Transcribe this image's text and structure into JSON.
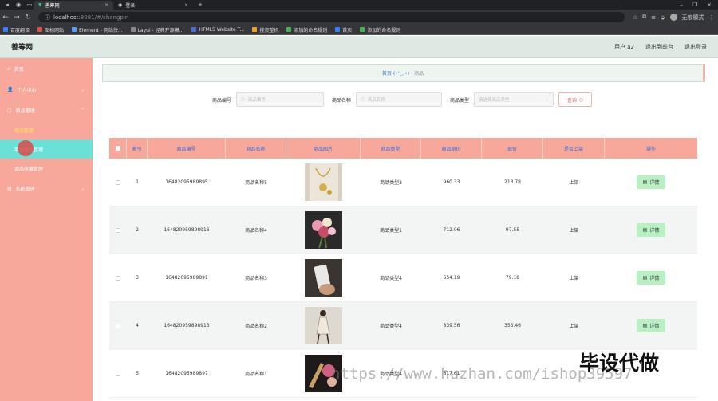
{
  "browser": {
    "tabs": [
      {
        "label": "善筹网"
      },
      {
        "label": "登录"
      }
    ],
    "url_host": "localhost",
    "url_path": ":8081/#/shangpin",
    "profile_label": "无痕模式",
    "bookmarks": [
      {
        "label": "百度翻译",
        "color": "#3b7cff"
      },
      {
        "label": "图标网站",
        "color": "#e0504a"
      },
      {
        "label": "Element - 网站快...",
        "color": "#4fa0ff"
      },
      {
        "label": "Layui - 经典开源模...",
        "color": "#888888"
      },
      {
        "label": "HTML5 Website T...",
        "color": "#4f6bd8"
      },
      {
        "label": "搜资整机",
        "color": "#f0a030"
      },
      {
        "label": "添加的命名规则",
        "color": "#4caf50"
      },
      {
        "label": "首页",
        "color": "#3b7cff"
      },
      {
        "label": "添加的命名规则",
        "color": "#4caf50"
      }
    ]
  },
  "header": {
    "logo": "善筹网",
    "user": "用户 a2",
    "back": "退出到前台",
    "logout": "退出登录"
  },
  "sidebar": {
    "home": "首页",
    "personal": "个人中心",
    "goods_mgmt": "商品管理",
    "sub_yellow": "商品管理",
    "sub_active": "商品类型管理",
    "sub_3": "商品收藏管理",
    "system": "系统管理"
  },
  "breadcrumb": {
    "home": "首页",
    "face": "(•'◡'•)",
    "current": "商品"
  },
  "filters": {
    "code_label": "商品编号",
    "code_placeholder": "商品编号",
    "name_label": "商品名称",
    "name_placeholder": "商品名称",
    "type_label": "商品类型",
    "type_placeholder": "请选择商品类型",
    "query": "查询"
  },
  "table": {
    "headers": [
      "索引",
      "商品编号",
      "商品名称",
      "商品图片",
      "商品类型",
      "商品原价",
      "现价",
      "是否上架",
      "操作"
    ],
    "detail_label": "详情",
    "rows": [
      {
        "index": "1",
        "code": "16482095989895",
        "name": "商品名称5",
        "type": "商品类型3",
        "orig": "960.33",
        "price": "213.78",
        "status": "上架"
      },
      {
        "index": "2",
        "code": "164820959898916",
        "name": "商品名称4",
        "type": "商品类型1",
        "orig": "712.06",
        "price": "97.55",
        "status": "上架"
      },
      {
        "index": "3",
        "code": "16482095989891",
        "name": "商品名称3",
        "type": "商品类型4",
        "orig": "654.19",
        "price": "79.18",
        "status": "上架"
      },
      {
        "index": "4",
        "code": "164820959898913",
        "name": "商品名称2",
        "type": "商品类型4",
        "orig": "839.56",
        "price": "355.46",
        "status": "上架"
      },
      {
        "index": "5",
        "code": "16482095989897",
        "name": "商品名称1",
        "type": "商品类型4",
        "orig": "817.61",
        "price": "",
        "status": ""
      }
    ]
  },
  "watermark": {
    "url": "https://www.huzhan.com/ishop39597",
    "brand": "毕设代做"
  },
  "colors": {
    "sidebar": "#f7a89b",
    "active": "#6ae0d6",
    "table_head": "#f7a89b",
    "link": "#3a6cd8",
    "detail_btn": "#b8f0c4"
  }
}
